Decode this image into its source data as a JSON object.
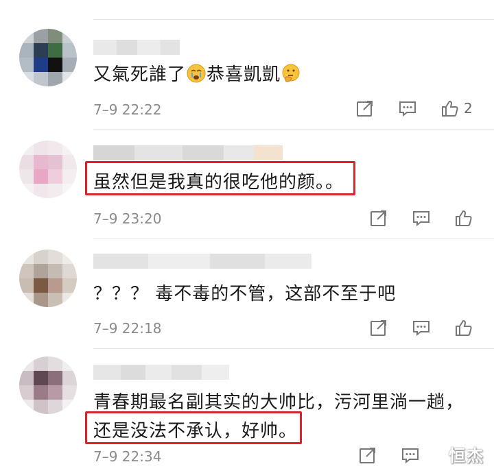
{
  "comments": [
    {
      "text_before_emoji1": "又氣死誰了",
      "emoji1": "cry-face-emoji",
      "text_between": "恭喜凱凱",
      "emoji2": "thinking-face-emoji",
      "time": "7–9 22:22",
      "like_count": "2"
    },
    {
      "text": "虽然但是我真的很吃他的颜。。",
      "time": "7–9 23:20",
      "like_count": ""
    },
    {
      "text": "？？？ 毒不毒的不管，这部不至于吧",
      "time": "7–9 22:18",
      "like_count": ""
    },
    {
      "text_line1": "青春期最名副其实的大帅比，污河里淌一趟，",
      "text_line2": "还是没法不承认，好帅。",
      "time": "7–9 22:34",
      "like_count": ""
    }
  ],
  "icons": {
    "share": "share-icon",
    "comment": "comment-icon",
    "like": "thumbs-up-icon"
  },
  "colors": {
    "highlight_border": "#d9232b",
    "time_text": "#8a8a8a"
  },
  "watermark": "恒杰"
}
